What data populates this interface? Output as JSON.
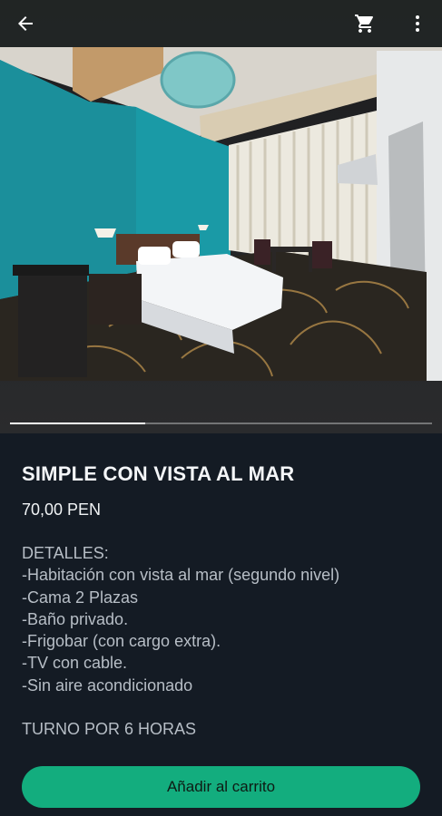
{
  "topbar": {
    "back_icon": "arrow-left-icon",
    "cart_icon": "shopping-cart-icon",
    "more_icon": "more-vertical-icon"
  },
  "gallery": {
    "image": "hotel room photo",
    "pager_progress": 0.32
  },
  "product": {
    "title": "SIMPLE CON VISTA AL MAR",
    "price": "70,00 PEN",
    "description": [
      "DETALLES:",
      "-Habitación con vista al mar (segundo nivel)",
      "-Cama 2 Plazas",
      "-Baño privado.",
      "-Frigobar (con cargo extra).",
      "-TV con cable.",
      "-Sin aire acondicionado"
    ],
    "shift_note": "TURNO POR 6 HORAS"
  },
  "actions": {
    "add_to_cart_label": "Añadir al carrito"
  },
  "colors": {
    "accent": "#13ad7e",
    "background": "#141b24"
  }
}
